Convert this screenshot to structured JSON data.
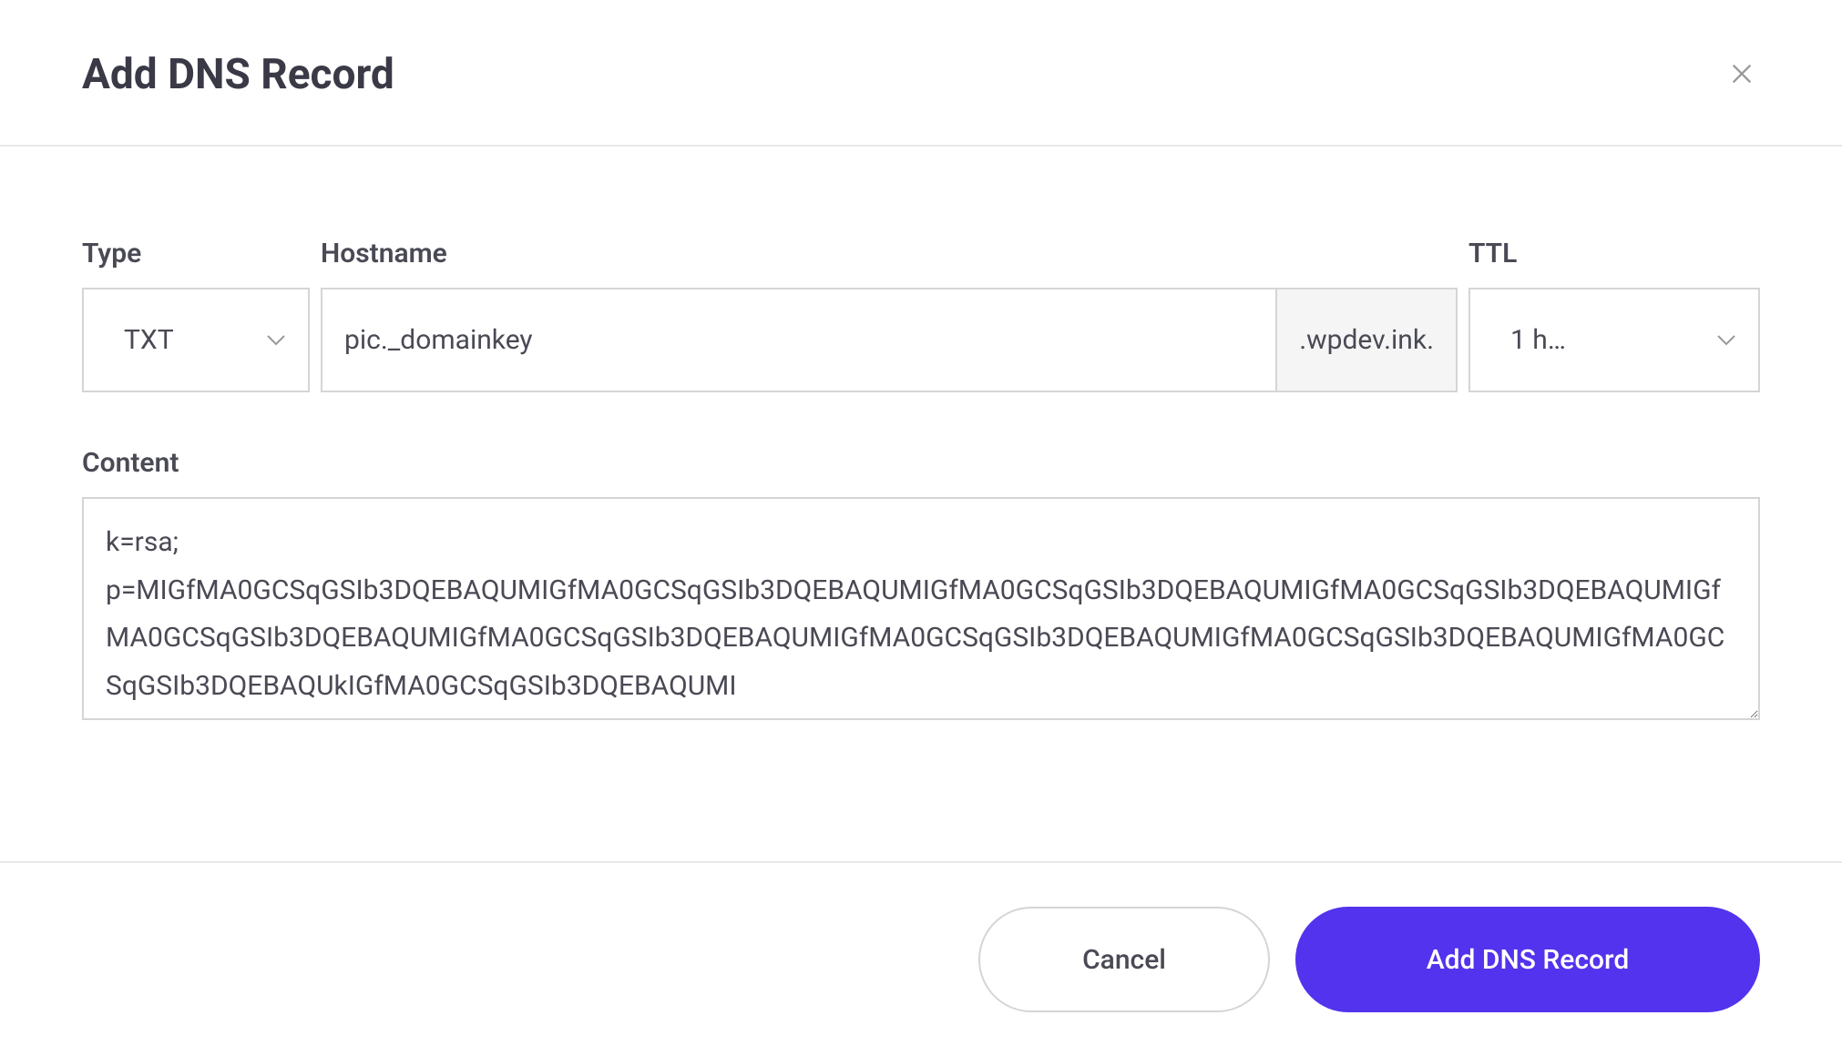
{
  "header": {
    "title": "Add DNS Record"
  },
  "form": {
    "type": {
      "label": "Type",
      "value": "TXT"
    },
    "hostname": {
      "label": "Hostname",
      "value": "pic._domainkey",
      "suffix": ".wpdev.ink."
    },
    "ttl": {
      "label": "TTL",
      "value": "1 h…"
    },
    "content": {
      "label": "Content",
      "value": "k=rsa;\np=MIGfMA0GCSqGSIb3DQEBAQUMIGfMA0GCSqGSIb3DQEBAQUMIGfMA0GCSqGSIb3DQEBAQUMIGfMA0GCSqGSIb3DQEBAQUMIGfMA0GCSqGSIb3DQEBAQUMIGfMA0GCSqGSIb3DQEBAQUMIGfMA0GCSqGSIb3DQEBAQUMIGfMA0GCSqGSIb3DQEBAQUMIGfMA0GCSqGSIb3DQEBAQUkIGfMA0GCSqGSIb3DQEBAQUMI"
    }
  },
  "footer": {
    "cancel": "Cancel",
    "submit": "Add DNS Record"
  }
}
